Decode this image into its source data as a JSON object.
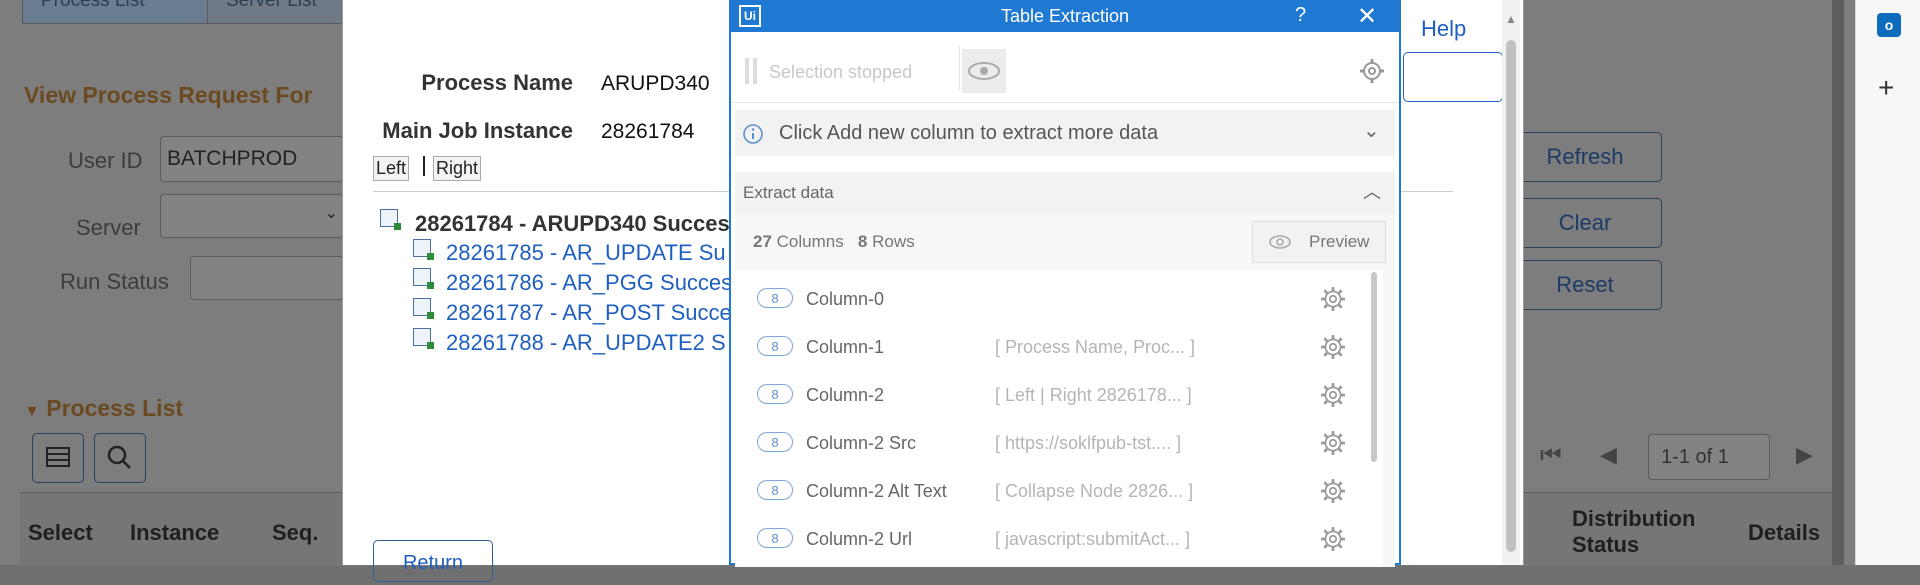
{
  "background": {
    "tabs": [
      "Process List",
      "Server List"
    ],
    "view_title": "View Process Request For",
    "user_id_label": "User ID",
    "user_id_value": "BATCHPROD",
    "server_label": "Server",
    "run_status_label": "Run Status",
    "buttons": {
      "refresh": "Refresh",
      "clear": "Clear",
      "reset": "Reset"
    },
    "process_list_title": "Process List",
    "pagination": "1-1 of 1",
    "columns": [
      "Select",
      "Instance",
      "Seq.",
      "Distribution Status",
      "Details"
    ]
  },
  "modal": {
    "help": "Help",
    "process_name_label": "Process Name",
    "process_name_value": "ARUPD340",
    "main_job_label": "Main Job Instance",
    "main_job_value": "28261784",
    "left_btn": "Left",
    "right_btn": "Right",
    "tree_root": "28261784 - ARUPD340 Succes",
    "tree_items": [
      "28261785 - AR_UPDATE Su",
      "28261786 - AR_PGG Succes",
      "28261787 - AR_POST Succe",
      "28261788 - AR_UPDATE2 S"
    ],
    "return_btn": "Return"
  },
  "panel": {
    "title": "Table Extraction",
    "help_icon": "?",
    "close_icon": "✕",
    "selection_status": "Selection stopped",
    "info_text": "Click Add new column to extract more data",
    "extract_title": "Extract data",
    "columns_count": "27",
    "columns_label": "Columns",
    "rows_count": "8",
    "rows_label": "Rows",
    "preview_label": "Preview",
    "columns": [
      {
        "badge": "8",
        "name": "Column-0",
        "preview": ""
      },
      {
        "badge": "8",
        "name": "Column-1",
        "preview": "[ Process Name, Proc... ]"
      },
      {
        "badge": "8",
        "name": "Column-2",
        "preview": "[ Left | Right 2826178... ]"
      },
      {
        "badge": "8",
        "name": "Column-2 Src",
        "preview": "[ https://soklfpub-tst.... ]"
      },
      {
        "badge": "8",
        "name": "Column-2 Alt Text",
        "preview": "[ Collapse Node 2826... ]"
      },
      {
        "badge": "8",
        "name": "Column-2 Url",
        "preview": "[ javascript:submitAct... ]"
      }
    ]
  },
  "colors": {
    "accent": "#1f78d1",
    "link": "#1f5fbf",
    "dim_bg": "#7d7d7d"
  }
}
